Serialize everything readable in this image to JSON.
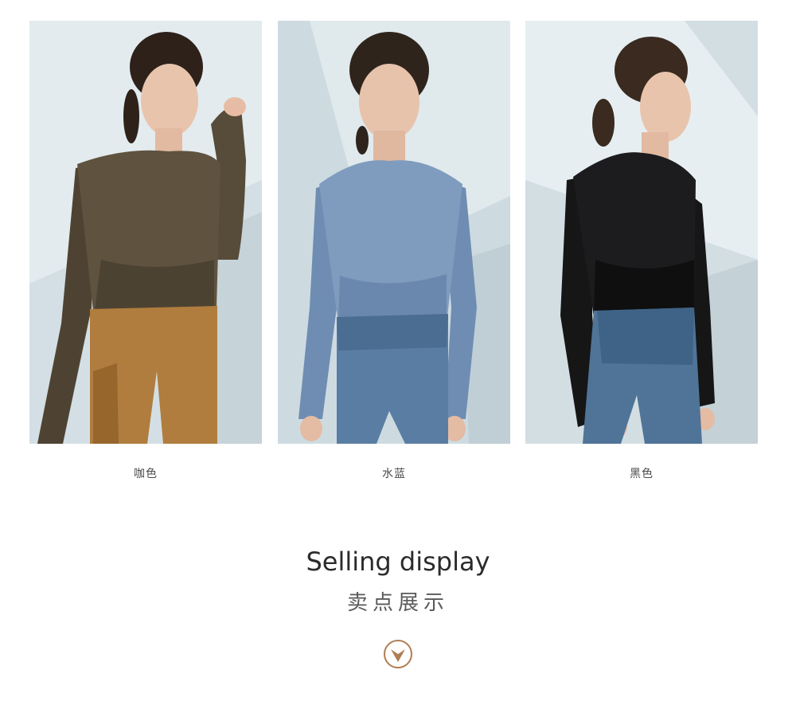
{
  "products": [
    {
      "color_name": "咖色",
      "image_alt": "model in brown long-sleeve crop top with camel leggings",
      "palette": {
        "top": "#5f5340",
        "top_shade": "#4c4232",
        "bottom": "#b07d3e",
        "bottom_shade": "#96662d",
        "bg": "#d3dfe4",
        "bg_light": "#e6eef1"
      }
    },
    {
      "color_name": "水蓝",
      "image_alt": "model in light blue long-sleeve crop top with blue leggings",
      "palette": {
        "top": "#7f9cbf",
        "top_shade": "#6a88ad",
        "bottom": "#5a7ea3",
        "bottom_shade": "#4a6d91",
        "bg": "#cddbe1",
        "bg_light": "#e3ecef"
      }
    },
    {
      "color_name": "黑色",
      "image_alt": "model in black long-sleeve crop top with blue leggings",
      "palette": {
        "top": "#1c1c1e",
        "top_shade": "#0f0f10",
        "bottom": "#4f7497",
        "bottom_shade": "#3f6386",
        "bg": "#d3dee3",
        "bg_light": "#e6eef1"
      }
    }
  ],
  "section": {
    "title_en": "Selling display",
    "title_cn": "卖点展示"
  },
  "scroll_button": {
    "icon": "chevron-down-icon",
    "accent": "#b07d52"
  }
}
